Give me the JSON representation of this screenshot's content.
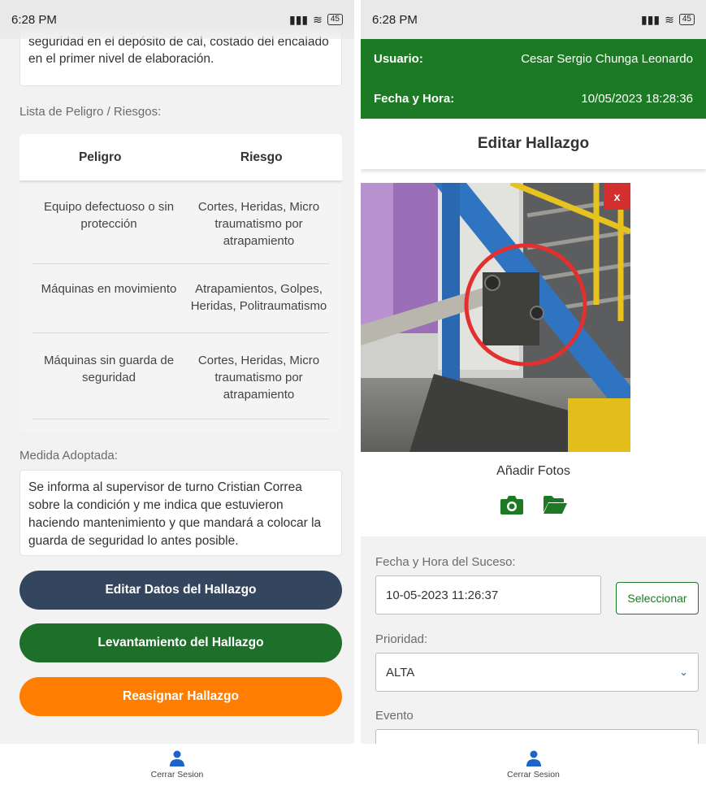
{
  "left": {
    "status": {
      "time": "6:28 PM",
      "battery": "45"
    },
    "description_text": "seguridad en el depósito de cal, costado del encalado en el primer nivel de elaboración.",
    "risk_list_label": "Lista de Peligro / Riesgos:",
    "risk_table": {
      "headers": [
        "Peligro",
        "Riesgo"
      ],
      "rows": [
        {
          "peligro": "Equipo defectuoso o sin protección",
          "riesgo": "Cortes, Heridas, Micro traumatismo por atrapamiento"
        },
        {
          "peligro": "Máquinas en movimiento",
          "riesgo": "Atrapamientos, Golpes, Heridas, Politraumatismo"
        },
        {
          "peligro": "Máquinas sin guarda de seguridad",
          "riesgo": "Cortes, Heridas, Micro traumatismo por atrapamiento"
        }
      ]
    },
    "measure_label": "Medida Adoptada:",
    "measure_text": "Se informa al supervisor de turno Cristian Correa sobre la condición y me indica que estuvieron haciendo mantenimiento y que mandará a colocar la guarda de seguridad lo antes posible.",
    "buttons": {
      "edit": "Editar Datos del Hallazgo",
      "lift": "Levantamiento del Hallazgo",
      "reassign": "Reasignar Hallazgo"
    },
    "nav_label": "Cerrar Sesion"
  },
  "right": {
    "status": {
      "time": "6:28 PM",
      "battery": "45"
    },
    "header": {
      "user_label": "Usuario:",
      "user_value": "Cesar Sergio Chunga Leonardo",
      "datetime_label": "Fecha y Hora:",
      "datetime_value": "10/05/2023 18:28:36"
    },
    "title": "Editar Hallazgo",
    "close_label": "x",
    "add_photos": "Añadir Fotos",
    "form": {
      "event_date_label": "Fecha y Hora del Suceso:",
      "event_date_value": "10-05-2023 11:26:37",
      "select_button": "Seleccionar",
      "priority_label": "Prioridad:",
      "priority_value": "ALTA",
      "event_label": "Evento"
    },
    "nav_label": "Cerrar Sesion"
  },
  "colors": {
    "header_green": "#1c7a24",
    "edit_button": "#34465e",
    "lift_button": "#1e6f2a",
    "reassign_button": "#ff7d00",
    "close_red": "#d32f2f",
    "nav_blue": "#1e64c8"
  }
}
